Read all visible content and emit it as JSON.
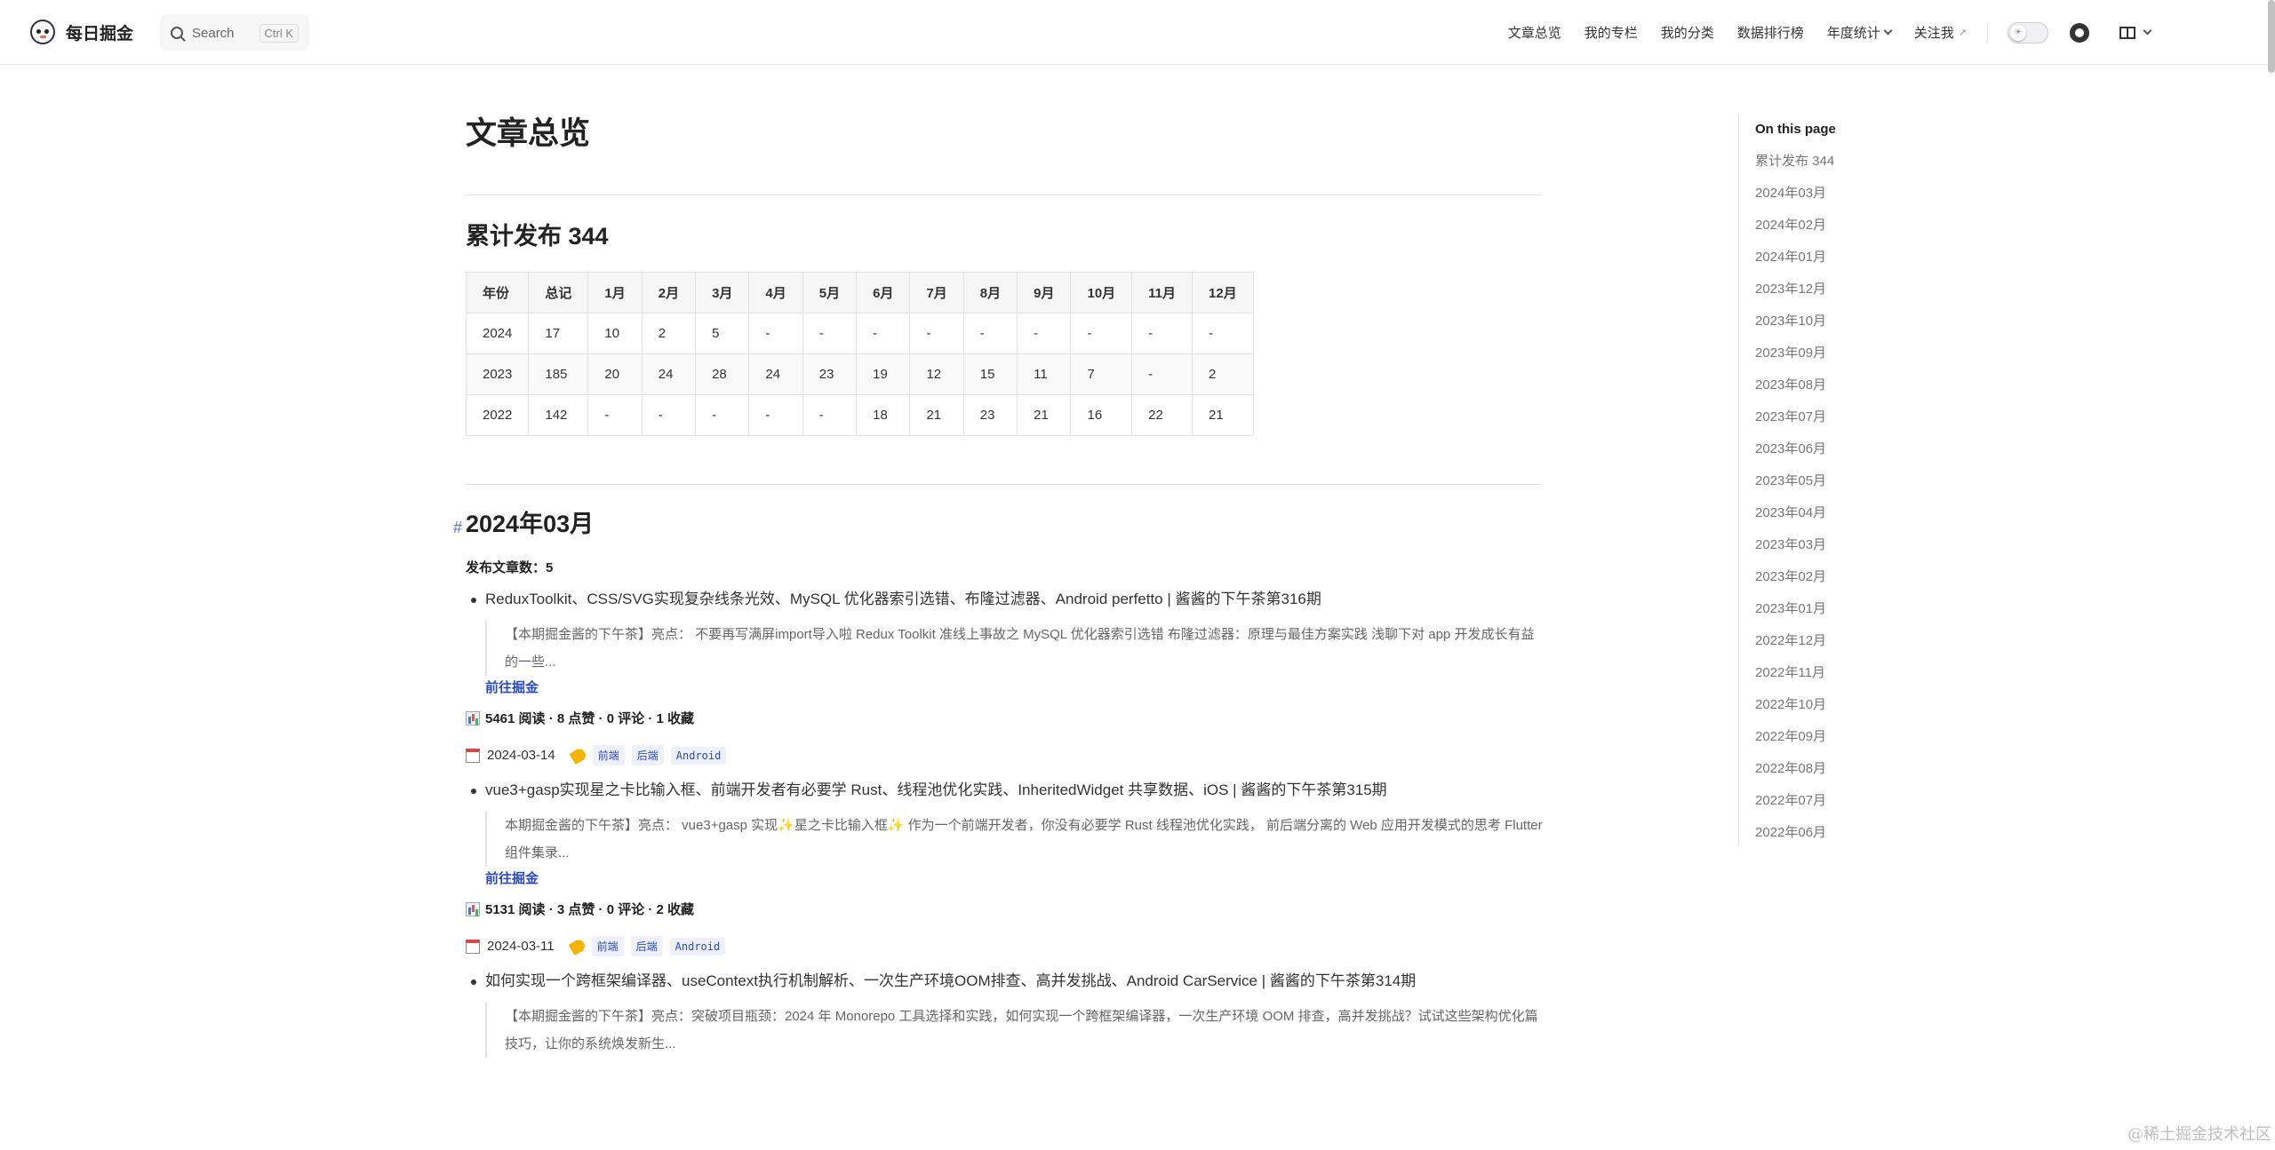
{
  "nav": {
    "brand": "每日掘金",
    "search_label": "Search",
    "search_kbd": "Ctrl K",
    "menu": [
      {
        "label": "文章总览",
        "dropdown": false,
        "external": false
      },
      {
        "label": "我的专栏",
        "dropdown": false,
        "external": false
      },
      {
        "label": "我的分类",
        "dropdown": false,
        "external": false
      },
      {
        "label": "数据排行榜",
        "dropdown": false,
        "external": false
      },
      {
        "label": "年度统计",
        "dropdown": true,
        "external": false
      },
      {
        "label": "关注我",
        "dropdown": false,
        "external": true
      }
    ],
    "external_icon": "↗"
  },
  "page": {
    "title": "文章总览",
    "summary_heading": "累计发布 344",
    "table": {
      "headers": [
        "年份",
        "总记",
        "1月",
        "2月",
        "3月",
        "4月",
        "5月",
        "6月",
        "7月",
        "8月",
        "9月",
        "10月",
        "11月",
        "12月"
      ],
      "rows": [
        [
          "2024",
          "17",
          "10",
          "2",
          "5",
          "-",
          "-",
          "-",
          "-",
          "-",
          "-",
          "-",
          "-",
          "-"
        ],
        [
          "2023",
          "185",
          "20",
          "24",
          "28",
          "24",
          "23",
          "19",
          "12",
          "15",
          "11",
          "7",
          "-",
          "2"
        ],
        [
          "2022",
          "142",
          "-",
          "-",
          "-",
          "-",
          "-",
          "18",
          "21",
          "23",
          "21",
          "16",
          "22",
          "21"
        ]
      ]
    },
    "month_section": {
      "anchor": "#",
      "heading": "2024年03月",
      "count_label": "发布文章数：",
      "count_value": "5",
      "articles": [
        {
          "title": "ReduxToolkit、CSS/SVG实现复杂线条光效、MySQL 优化器索引选错、布隆过滤器、Android perfetto | 酱酱的下午茶第316期",
          "excerpt": "【本期掘金酱的下午茶】亮点：  不要再写满屏import导入啦 Redux Toolkit 准线上事故之 MySQL 优化器索引选错 布隆过滤器：原理与最佳方案实践 浅聊下对 app 开发成长有益的一些...",
          "link": "前往掘金",
          "stats": "5461 阅读 · 8 点赞 · 0 评论 · 1 收藏",
          "date": "2024-03-14",
          "tags": [
            "前端",
            "后端",
            "Android"
          ]
        },
        {
          "title": "vue3+gasp实现星之卡比输入框、前端开发者有必要学 Rust、线程池优化实践、InheritedWidget 共享数据、iOS | 酱酱的下午茶第315期",
          "excerpt": "本期掘金酱的下午茶】亮点：  vue3+gasp 实现✨星之卡比输入框✨ 作为一个前端开发者，你没有必要学 Rust 线程池优化实践， 前后端分离的 Web 应用开发模式的思考 Flutter 组件集录...",
          "link": "前往掘金",
          "stats": "5131 阅读 · 3 点赞 · 0 评论 · 2 收藏",
          "date": "2024-03-11",
          "tags": [
            "前端",
            "后端",
            "Android"
          ]
        },
        {
          "title": "如何实现一个跨框架编译器、useContext执行机制解析、一次生产环境OOM排查、高并发挑战、Android CarService | 酱酱的下午茶第314期",
          "excerpt": "【本期掘金酱的下午茶】亮点：突破项目瓶颈：2024 年 Monorepo 工具选择和实践，如何实现一个跨框架编译器，一次生产环境 OOM 排查，高并发挑战？试试这些架构优化篇技巧，让你的系统焕发新生..."
        }
      ]
    }
  },
  "aside": {
    "title": "On this page",
    "items": [
      "累计发布 344",
      "2024年03月",
      "2024年02月",
      "2024年01月",
      "2023年12月",
      "2023年10月",
      "2023年09月",
      "2023年08月",
      "2023年07月",
      "2023年06月",
      "2023年05月",
      "2023年04月",
      "2023年03月",
      "2023年02月",
      "2023年01月",
      "2022年12月",
      "2022年11月",
      "2022年10月",
      "2022年09月",
      "2022年08月",
      "2022年07月",
      "2022年06月"
    ]
  },
  "watermark": "@稀土掘金技术社区"
}
